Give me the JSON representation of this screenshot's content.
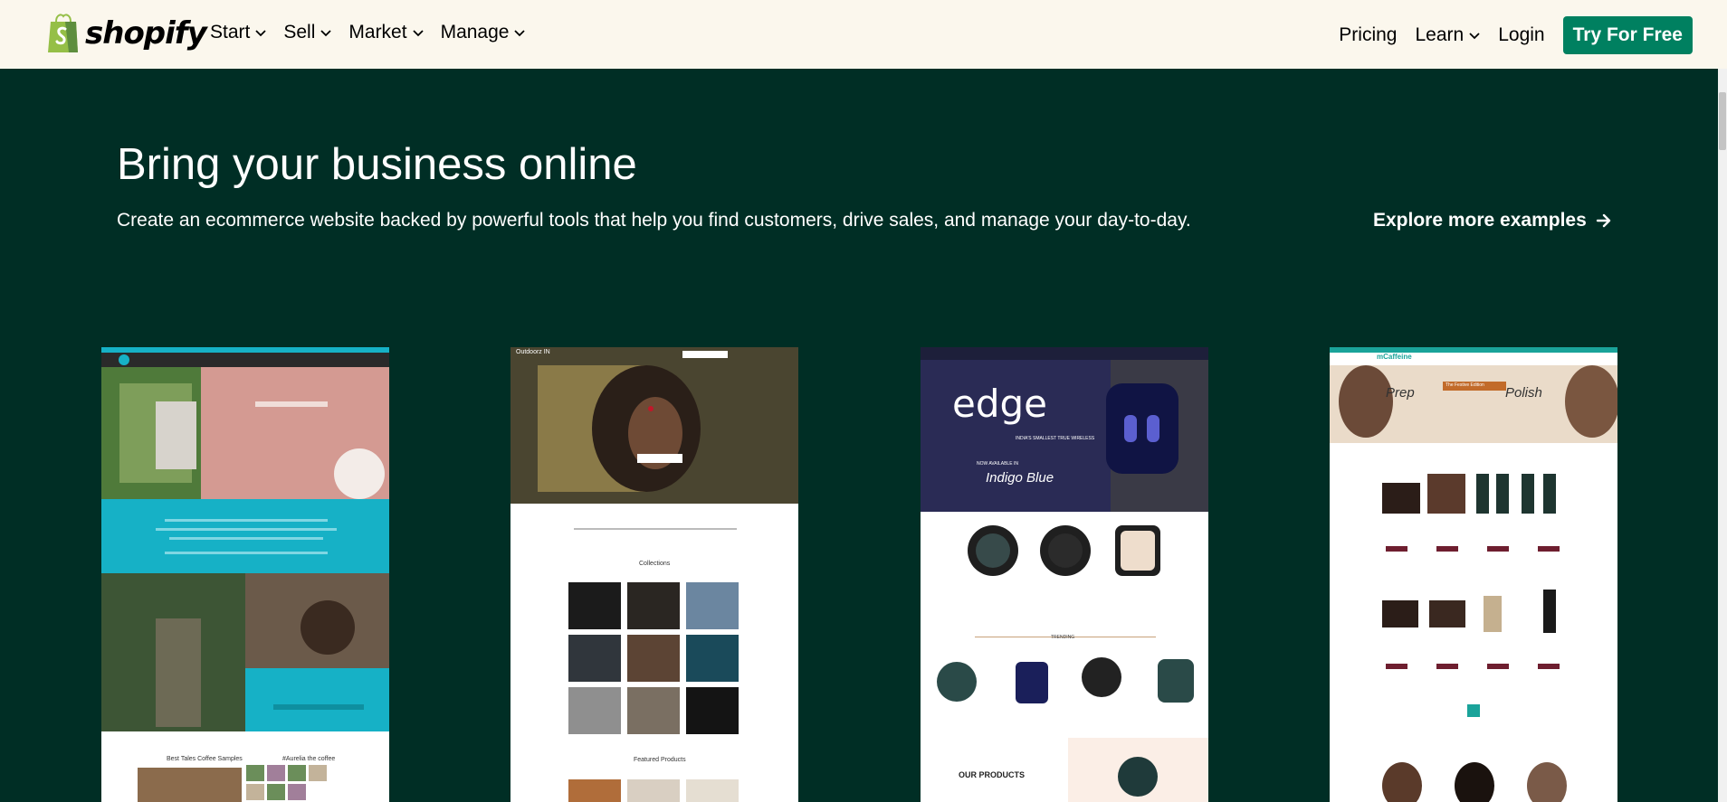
{
  "header": {
    "logo_text": "shopify",
    "menu": [
      {
        "label": "Start"
      },
      {
        "label": "Sell"
      },
      {
        "label": "Market"
      },
      {
        "label": "Manage"
      }
    ],
    "pricing": "Pricing",
    "learn": "Learn",
    "login": "Login",
    "cta": "Try For Free"
  },
  "hero": {
    "title": "Bring your business online",
    "subtitle": "Create an ecommerce website backed by powerful tools that help you find customers, drive sales, and manage your day-to-day.",
    "explore": "Explore more examples"
  },
  "examples": [
    {
      "caption_a": "Best Tales Coffee Samples",
      "caption_b": "#Aurelia the coffee"
    },
    {
      "brand": "Outdoorz IN",
      "caption_a": "Collections",
      "caption_b": "Featured Products"
    },
    {
      "brand": "edge",
      "tagline_a": "INDIA'S SMALLEST TRUE WIRELESS",
      "tagline_b": "NOW AVAILABLE IN",
      "tagline_c": "Indigo Blue",
      "section": "TRENDING",
      "products": "OUR PRODUCTS"
    },
    {
      "brand": "mCaffeine",
      "banner_a": "Prep",
      "banner_b": "Polish",
      "banner_c": "The Festive Edition"
    }
  ],
  "colors": {
    "bg": "#002e25",
    "nav_bg": "#fbf7ed",
    "accent": "#008060"
  }
}
